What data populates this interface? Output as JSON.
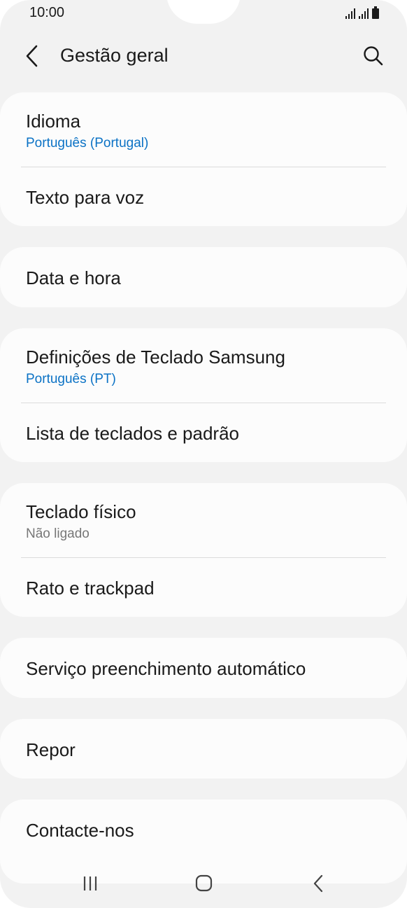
{
  "status": {
    "time": "10:00"
  },
  "header": {
    "title": "Gestão geral"
  },
  "groups": [
    {
      "items": [
        {
          "title": "Idioma",
          "subtitle": "Português (Portugal)"
        },
        {
          "title": "Texto para voz"
        }
      ]
    },
    {
      "items": [
        {
          "title": "Data e hora"
        }
      ]
    },
    {
      "items": [
        {
          "title": "Definições de Teclado Samsung",
          "subtitle": "Português (PT)"
        },
        {
          "title": "Lista de teclados e padrão"
        }
      ]
    },
    {
      "items": [
        {
          "title": "Teclado físico",
          "subtitle": "Não ligado"
        },
        {
          "title": "Rato e trackpad"
        }
      ]
    },
    {
      "items": [
        {
          "title": "Serviço preenchimento automático"
        }
      ]
    },
    {
      "items": [
        {
          "title": "Repor"
        }
      ]
    },
    {
      "items": [
        {
          "title": "Contacte-nos"
        }
      ]
    }
  ],
  "colors": {
    "accent": "#0b72c5",
    "background": "#f2f2f2",
    "card": "#fcfcfc"
  },
  "icons": {
    "back": "chevron-left-icon",
    "search": "search-icon",
    "recents": "recents-icon",
    "home": "home-icon",
    "nav_back": "nav-back-icon"
  }
}
